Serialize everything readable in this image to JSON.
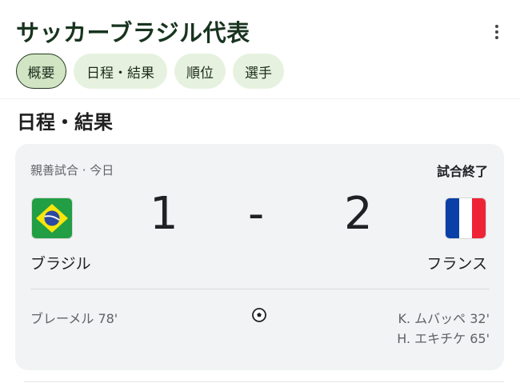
{
  "page": {
    "title": "サッカーブラジル代表"
  },
  "chips": [
    {
      "label": "概要",
      "active": true
    },
    {
      "label": "日程・結果",
      "active": false
    },
    {
      "label": "順位",
      "active": false
    },
    {
      "label": "選手",
      "active": false
    }
  ],
  "section": {
    "title": "日程・結果"
  },
  "match": {
    "meta": "親善試合 · 今日",
    "status": "試合終了",
    "home": {
      "name": "ブラジル",
      "score": "1",
      "flag": "brazil-flag-icon"
    },
    "separator": "-",
    "away": {
      "name": "フランス",
      "score": "2",
      "flag": "france-flag-icon"
    },
    "home_scorers": [
      "ブレーメル 78'"
    ],
    "away_scorers": [
      "K. ムバッペ 32'",
      "H. エキチケ 65'"
    ],
    "event_icon": "soccer-ball-icon"
  },
  "colors": {
    "title": "#18341f",
    "chip_bg": "#e6f2df",
    "chip_active_bg": "#d1e5c5",
    "card_bg": "#f1f3f4"
  }
}
